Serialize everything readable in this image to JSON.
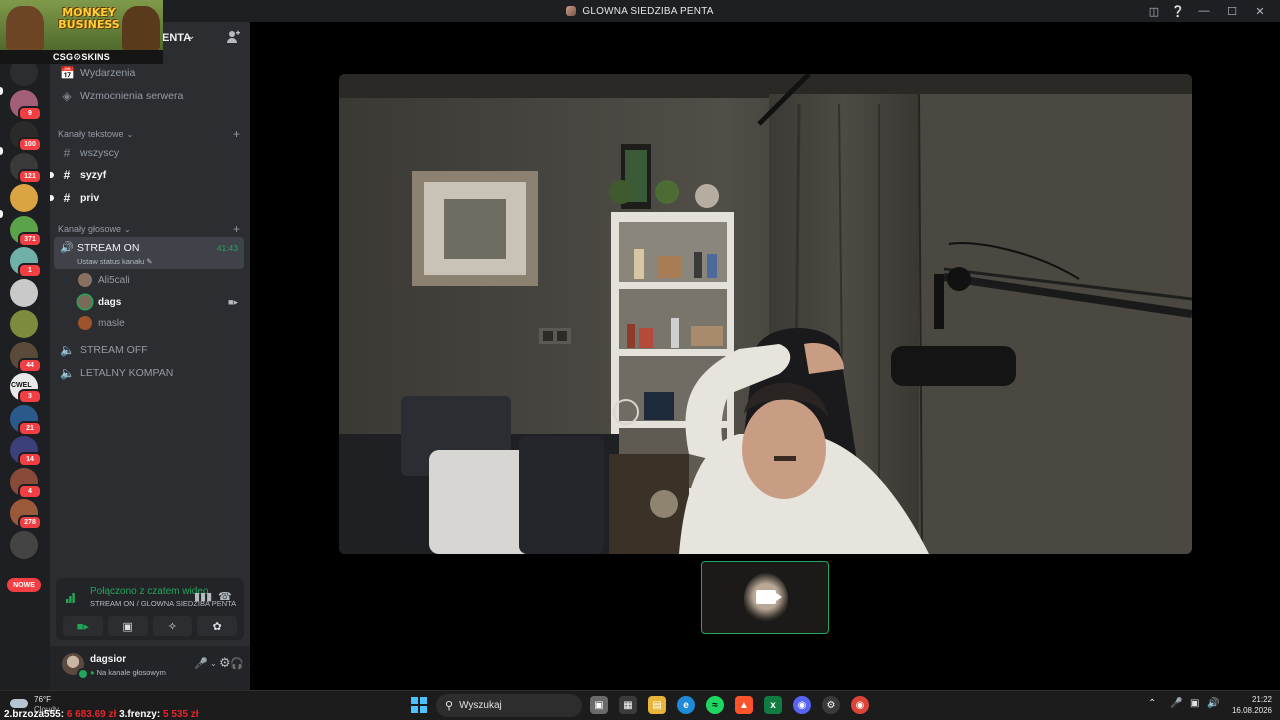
{
  "window": {
    "title": "GLOWNA SIEDZIBA PENTA"
  },
  "ad": {
    "game_logo_line1": "MONKEY",
    "game_logo_line2": "BUSINESS",
    "sponsor": "CSG⚙SKINS"
  },
  "server_rail": {
    "servers": [
      {
        "icon": "server-icon",
        "color": "#2b2d31",
        "badge": ""
      },
      {
        "icon": "server-icon",
        "color": "#a35f7a",
        "badge": "9"
      },
      {
        "icon": "server-icon",
        "color": "#2a2a2a",
        "badge": "100"
      },
      {
        "icon": "server-icon",
        "color": "#3a3a3a",
        "badge": "121"
      },
      {
        "icon": "server-icon",
        "color": "#d9a441",
        "badge": ""
      },
      {
        "icon": "server-icon",
        "color": "#5aa34a",
        "badge": "371"
      },
      {
        "icon": "server-icon",
        "color": "#6fb0a8",
        "badge": "1"
      },
      {
        "icon": "server-icon",
        "color": "#c9c9c9",
        "badge": ""
      },
      {
        "icon": "server-icon",
        "color": "#7d8b3f",
        "badge": ""
      },
      {
        "icon": "server-icon",
        "color": "#5a4a3a",
        "badge": "44"
      },
      {
        "icon": "server-icon",
        "color": "#e8e8e8",
        "badge": "3"
      },
      {
        "icon": "server-icon",
        "color": "#2a5a8a",
        "badge": "21"
      },
      {
        "icon": "server-icon",
        "color": "#3b3f7a",
        "badge": "14"
      },
      {
        "icon": "server-icon",
        "color": "#8a4a3a",
        "badge": "4"
      },
      {
        "icon": "server-icon",
        "color": "#9a5a3a",
        "badge": "278"
      },
      {
        "icon": "server-icon",
        "color": "#444",
        "badge": ""
      }
    ],
    "new_label": "NOWE",
    "cwel_text": "CWEL"
  },
  "sidebar": {
    "server_name": "ENTA",
    "events": "Wydarzenia",
    "boosts": "Wzmocnienia serwera",
    "text_category": "Kanały tekstowe",
    "text_channels": [
      "wszyscy",
      "syzyf",
      "priv"
    ],
    "voice_category": "Kanały głosowe",
    "active_voice": {
      "name": "STREAM ON",
      "timer": "41:43",
      "status": "Ustaw status kanału"
    },
    "members": [
      {
        "name": "Ali5cali",
        "color": "#8a7060"
      },
      {
        "name": "dags",
        "color": "#7a6a5a"
      },
      {
        "name": "masle",
        "color": "#a0522d"
      }
    ],
    "voice_channels": [
      "STREAM OFF",
      "LETALNY KOMPAN"
    ]
  },
  "voice_panel": {
    "state": "Połączono z czatem wideo",
    "location": "STREAM ON / GLOWNA SIEDZIBA PENTA"
  },
  "user_panel": {
    "username": "dagsior",
    "status": "Na kanale głosowym"
  },
  "taskbar": {
    "weather_temp": "76°F",
    "weather_desc": "Cloudy",
    "ticker_a": "2.brzoza555:",
    "ticker_a_val": "6 683.69 zł",
    "ticker_b": "3.frenzy:",
    "ticker_b_val": "5 535 zł",
    "search_placeholder": "Wyszukaj",
    "time": "21:22",
    "date": "16.08.2026"
  }
}
